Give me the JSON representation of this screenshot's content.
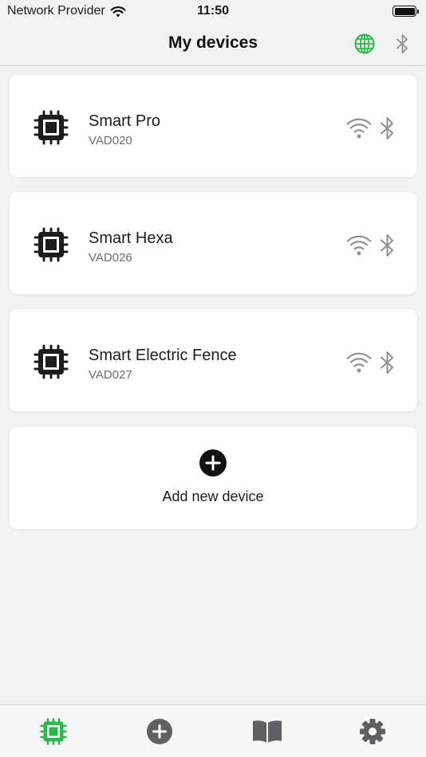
{
  "status_bar": {
    "carrier": "Network Provider",
    "time": "11:50",
    "wifi_icon": "wifi-icon",
    "battery_icon": "battery-icon"
  },
  "nav": {
    "title": "My devices",
    "globe_icon": "globe-icon",
    "bluetooth_icon": "bluetooth-icon"
  },
  "devices": [
    {
      "name": "Smart Pro",
      "code": "VAD020"
    },
    {
      "name": "Smart Hexa",
      "code": "VAD026"
    },
    {
      "name": "Smart Electric Fence",
      "code": "VAD027"
    }
  ],
  "add_device": {
    "label": "Add new device",
    "icon": "plus-circle-icon"
  },
  "tabs": [
    {
      "icon": "chip-icon",
      "active": true
    },
    {
      "icon": "plus-circle-icon",
      "active": false
    },
    {
      "icon": "book-icon",
      "active": false
    },
    {
      "icon": "gear-icon",
      "active": false
    }
  ],
  "colors": {
    "accent_green": "#2db84c",
    "icon_gray": "#8e8e93",
    "chip_dark": "#1c1c1e",
    "tab_gray": "#5f5f64"
  }
}
